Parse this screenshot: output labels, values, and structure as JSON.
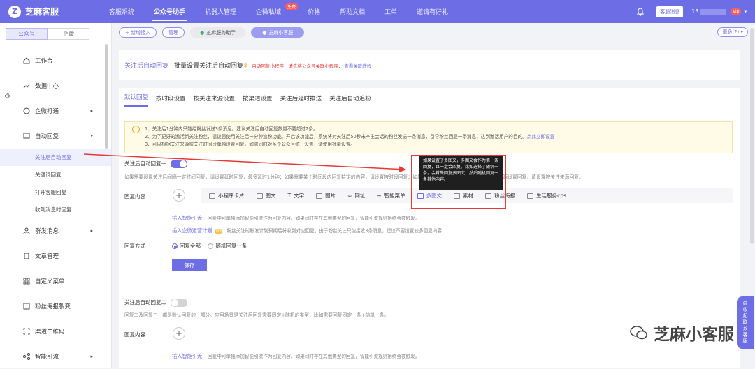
{
  "brand": {
    "name": "芝麻客服"
  },
  "topnav": [
    "客服系统",
    "公众号助手",
    "机器人管理",
    "企微私域",
    "价格",
    "帮助文档",
    "工单",
    "邀请有好礼"
  ],
  "topnav_active": 1,
  "free_badge": "免费",
  "topright": {
    "msg_button": "客服消息",
    "phone_prefix": "13",
    "vip_badge": "vip"
  },
  "side_tabs": [
    "公众号",
    "企微"
  ],
  "sidebar": {
    "items": [
      {
        "label": "工作台",
        "icon": "home-icon"
      },
      {
        "label": "数据中心",
        "icon": "chart-icon"
      },
      {
        "label": "企微打通",
        "icon": "link-icon",
        "arrow": "▸"
      },
      {
        "label": "自动回复",
        "icon": "message-icon",
        "arrow": "▾"
      }
    ],
    "sub_items": [
      "关注后自动回复",
      "关键词回复",
      "打开客服回复",
      "收到消息时回复"
    ],
    "items2": [
      {
        "label": "群发消息",
        "icon": "users-icon",
        "arrow": "▸"
      },
      {
        "label": "文章管理",
        "icon": "doc-icon"
      },
      {
        "label": "自定义菜单",
        "icon": "grid-icon"
      },
      {
        "label": "粉丝海报裂变",
        "icon": "poster-icon"
      },
      {
        "label": "渠道二维码",
        "icon": "qrcode-icon"
      },
      {
        "label": "智能引流",
        "icon": "share-icon",
        "arrow": "▸"
      }
    ]
  },
  "subbar": {
    "add": "+ 新增接入",
    "manage": "管理",
    "assistant": "芝麻服务助手",
    "mini": "芝麻小客服",
    "more": "更多(2) ▾"
  },
  "card1": {
    "tab_active": "关注后自动回复",
    "tab_batch": "批量设置关注后自动回复",
    "hint": "自动回复小程序，请先将公众号关联小程序，",
    "link": "查看关联教程"
  },
  "tabs2": [
    "默认回复",
    "按时段设置",
    "按关注来源设置",
    "按渠道设置",
    "关注后延时推送",
    "关注后自动追粉"
  ],
  "notice": [
    "1、关注后1分钟内只能给粉丝发送3条消息。建议关注后自动回复数量不要超过2条。",
    "2、为了更好的激活新关注粉丝，建议您使用关注后一分钟追粉功能。开启该功能后，系统将对关注后50秒未产生会话的粉丝发送一条消息，引导粉丝回复一条消息，达到激活用户的目的。",
    "3、可以根据关注来源或关注时间段单独设置回复。如需同时对多个公众号统一设置，请使用批量设置。"
  ],
  "notice_link": "点此立即设置",
  "reply1": {
    "label": "关注后自动回复一",
    "desc": "如果需要设置关注后间隔一定时间回复，请设置延时回复，最多延时1分钟；如果需要某个时间段内回复特定的内容，请设置按时段回复；如果需要按关注来源回复，请设置按关注来源设置回复，请设置按关注来源回复。"
  },
  "content_label": "回复内容",
  "types": [
    "小程序卡片",
    "图文",
    "文字",
    "图片",
    "网址",
    "智能菜单",
    "多图文",
    "素材",
    "粉丝海报",
    "生活服务cps"
  ],
  "smart1": {
    "link": "插入智能引流",
    "desc": "回复中可单独添加智能引流作为回复内容。如果同时存在其他类型的回复，智能引流规则始终会被触发。"
  },
  "smart2": {
    "link": "插入企微运营计划",
    "badge": "VIP",
    "desc": "粉丝关注时触发计划预期后将收到对应回复。由于粉丝关注只能接收3条消息，建议不要设置较多回复内容"
  },
  "mode_label": "回复方式",
  "mode_options": [
    "回复全部",
    "随机回复一条"
  ],
  "save": "保存",
  "tooltip": "如果设置了多图文，多图文会作为第一条回复，且一定会回复。比如选择了随机一条，会首先回复多图文，然后随机回复一条其他内容。",
  "reply2": {
    "label": "关注后自动回复二",
    "desc": "回复二及回复三，都是默认回复的一部分。应用场景是关注后回复需要固定+随机的类型，比如需要回复固定一条+随机一条。"
  },
  "float_panel": "收起联系客服",
  "watermark": "芝麻小客服",
  "colors": {
    "accent": "#6d6ee6",
    "annotation": "#e53935"
  }
}
